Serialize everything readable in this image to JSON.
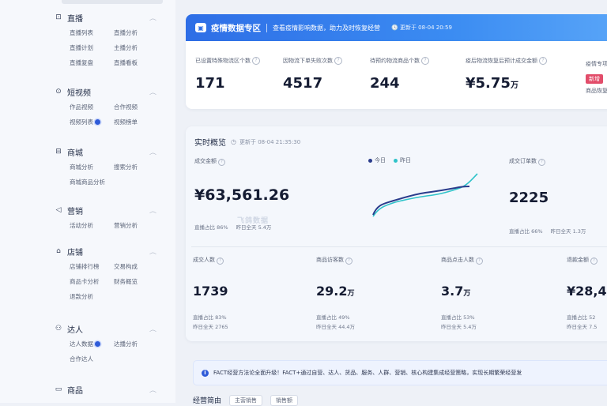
{
  "sidebar": {
    "groups": [
      {
        "title": "直播",
        "icon": "live-icon",
        "items": [
          "直播列表",
          "直播分析",
          "直播计划",
          "主播分析",
          "直播复盘",
          "直播看板"
        ],
        "dots": []
      },
      {
        "title": "短视频",
        "icon": "video-icon",
        "items": [
          "作品视频",
          "合作视频",
          "视频列表",
          "视频榜单"
        ],
        "dots": [
          2
        ]
      },
      {
        "title": "商城",
        "icon": "cart-icon",
        "items": [
          "商城分析",
          "搜索分析",
          "商城商品分析"
        ],
        "dots": []
      },
      {
        "title": "营销",
        "icon": "megaphone-icon",
        "items": [
          "活动分析",
          "营销分析"
        ],
        "dots": []
      },
      {
        "title": "店铺",
        "icon": "store-icon",
        "items": [
          "店铺排行榜",
          "交易构成",
          "商品卡分析",
          "财务概览",
          "退款分析"
        ],
        "dots": []
      },
      {
        "title": "达人",
        "icon": "person-icon",
        "items": [
          "达人数据",
          "达播分析",
          "合作达人"
        ],
        "dots": [
          0
        ]
      },
      {
        "title": "商品",
        "icon": "bag-icon",
        "items": [],
        "dots": []
      }
    ]
  },
  "banner": {
    "title": "疫情数据专区",
    "subtitle": "查看疫情影响数据，助力及时恢复经营",
    "updated": "更新于 08-04 20:59"
  },
  "stats": [
    {
      "label": "已设置特殊物流区个数",
      "value": "171",
      "unit": ""
    },
    {
      "label": "因物流下单失败次数",
      "value": "4517",
      "unit": ""
    },
    {
      "label": "待预约物流商品个数",
      "value": "244",
      "unit": ""
    },
    {
      "label": "疫后物流恢复后预计成交金额",
      "value": "¥5.75",
      "unit": "万"
    }
  ],
  "stats_extra": {
    "label": "疫情专项",
    "tag": "新增",
    "note": "商品恢复"
  },
  "realtime": {
    "title": "实时概览",
    "updated": "更新于 08-04 21:35:30",
    "gmv": {
      "label": "成交金额",
      "value": "¥63,561.26",
      "sub1": "直播占比 86%",
      "sub2": "昨日全天 5.4万"
    },
    "legend": [
      "今日",
      "昨日"
    ],
    "orders": {
      "label": "成交订单数",
      "value": "2225",
      "sub1": "直播占比 66%",
      "sub2": "昨日全天 1.3万"
    },
    "metrics": [
      {
        "label": "成交人数",
        "value": "1739",
        "unit": "",
        "sub1": "直播占比 83%",
        "sub2": "昨日全天 2765"
      },
      {
        "label": "商品访客数",
        "value": "29.2",
        "unit": "万",
        "sub1": "直播占比 49%",
        "sub2": "昨日全天 44.4万"
      },
      {
        "label": "商品点击人数",
        "value": "3.7",
        "unit": "万",
        "sub1": "直播占比 53%",
        "sub2": "昨日全天 5.4万"
      },
      {
        "label": "退款金额",
        "value": "¥28,44",
        "unit": "",
        "sub1": "直播占比 52",
        "sub2": "昨日全天 7.5"
      }
    ],
    "watermark": "飞鸽数据"
  },
  "notice": {
    "text": "FACT经营方法论全面升级！FACT+通过自营、达人、货品、服务、人群、营销、核心构建集成经营策略，实现长期繁荣经营发"
  },
  "bottom": {
    "title": "经营简由",
    "pill1": "主营销售",
    "pill2": "销售额"
  },
  "colors": {
    "accent": "#2f5bd8",
    "today_line": "#2a3c8c",
    "yesterday_line": "#2fc3c9",
    "tag": "#e24d6a"
  }
}
